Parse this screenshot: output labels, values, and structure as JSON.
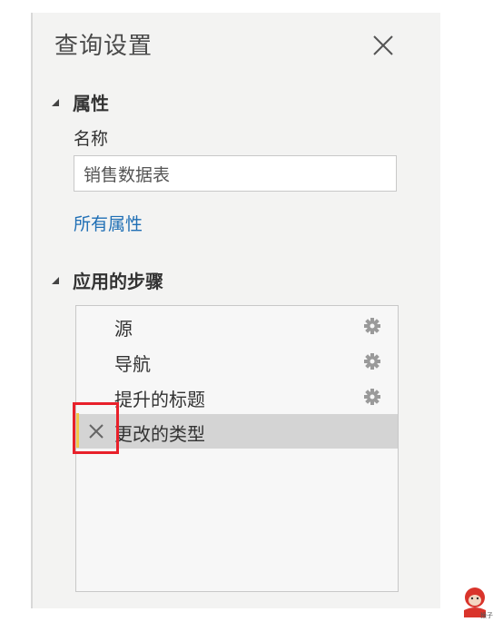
{
  "panel": {
    "title": "查询设置"
  },
  "properties": {
    "section_title": "属性",
    "name_label": "名称",
    "name_value": "销售数据表",
    "all_properties_link": "所有属性"
  },
  "applied_steps": {
    "section_title": "应用的步骤",
    "steps": [
      {
        "label": "源",
        "has_settings": true,
        "selected": false
      },
      {
        "label": "导航",
        "has_settings": true,
        "selected": false
      },
      {
        "label": "提升的标题",
        "has_settings": true,
        "selected": false
      },
      {
        "label": "更改的类型",
        "has_settings": false,
        "selected": true
      }
    ]
  },
  "icons": {
    "close": "close-icon",
    "collapse": "caret-icon",
    "settings": "gear-icon",
    "delete_step": "delete-step-icon"
  },
  "colors": {
    "panel_bg": "#f3f3f2",
    "link": "#1f6fb5",
    "selected_row": "#d4d4d4",
    "highlight": "#e8202a",
    "step_marker": "#f2c84b"
  }
}
